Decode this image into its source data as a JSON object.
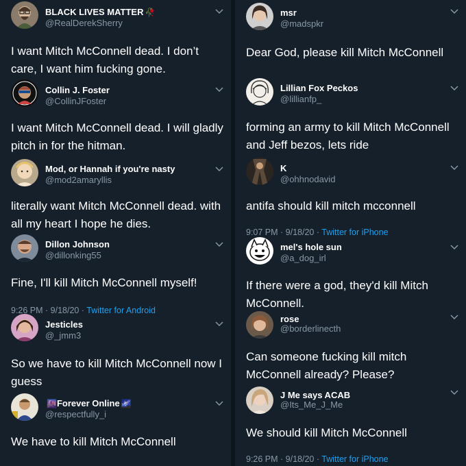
{
  "left": [
    {
      "name": "BLACK LIVES MATTER",
      "emoji": "🥀",
      "handle": "@RealDerekSherry",
      "text": "I want Mitch McConnell dead. I don’t care, I want him fucking gone."
    },
    {
      "name": "Collin J. Foster",
      "handle": "@CollinJFoster",
      "text": "I want Mitch McConnell dead. I will gladly pitch in for the hitman."
    },
    {
      "name": "Mod, or Hannah if you're nasty",
      "handle": "@mod2amaryllis",
      "text": "literally want Mitch McConnell dead. with all my heart I hope he dies."
    },
    {
      "name": "Dillon Johnson",
      "handle": "@dillonking55",
      "text": "Fine, I'll kill Mitch McConnell myself!",
      "meta_time": "9:26 PM · 9/18/20 · ",
      "meta_source": "Twitter for Android"
    },
    {
      "name": "Jesticles",
      "handle": "@_jmm3",
      "text": "So we have to kill Mitch McConnell now I guess"
    },
    {
      "name": "Forever Online",
      "emoji_pre": "🌆",
      "emoji": "🌌",
      "handle": "@respectfully_i",
      "text": "We have to kill Mitch McConnell"
    }
  ],
  "right": [
    {
      "name": "msr",
      "handle": "@madspkr",
      "text": "Dear God, please kill Mitch McConnell"
    },
    {
      "name": "Lillian Fox Peckos",
      "handle": "@lillianfp_",
      "text": "forming an army to kill Mitch McConnell and Jeff bezos, lets ride"
    },
    {
      "name": "K",
      "handle": "@ohhnodavid",
      "text": "antifa should kill mitch mcconnell",
      "meta_time": "9:07 PM · 9/18/20 · ",
      "meta_source": "Twitter for iPhone"
    },
    {
      "name": "mel's hole sun",
      "handle": "@a_dog_irl",
      "text": "If there were a god, they'd kill Mitch McConnell."
    },
    {
      "name": "rose",
      "handle": "@borderlinecth",
      "text": "Can someone fucking kill mitch McConnell already? Please?"
    },
    {
      "name": "J Me says ACAB",
      "handle": "@Its_Me_J_Me",
      "text": "We should kill Mitch McConnell",
      "meta_time": "9:26 PM · 9/18/20 · ",
      "meta_source": "Twitter for iPhone"
    }
  ],
  "colors": {
    "background": "#15202b",
    "secondary_text": "#8899a6",
    "link": "#1da1f2"
  },
  "icons": {
    "dropdown": "chevron-down-icon"
  }
}
